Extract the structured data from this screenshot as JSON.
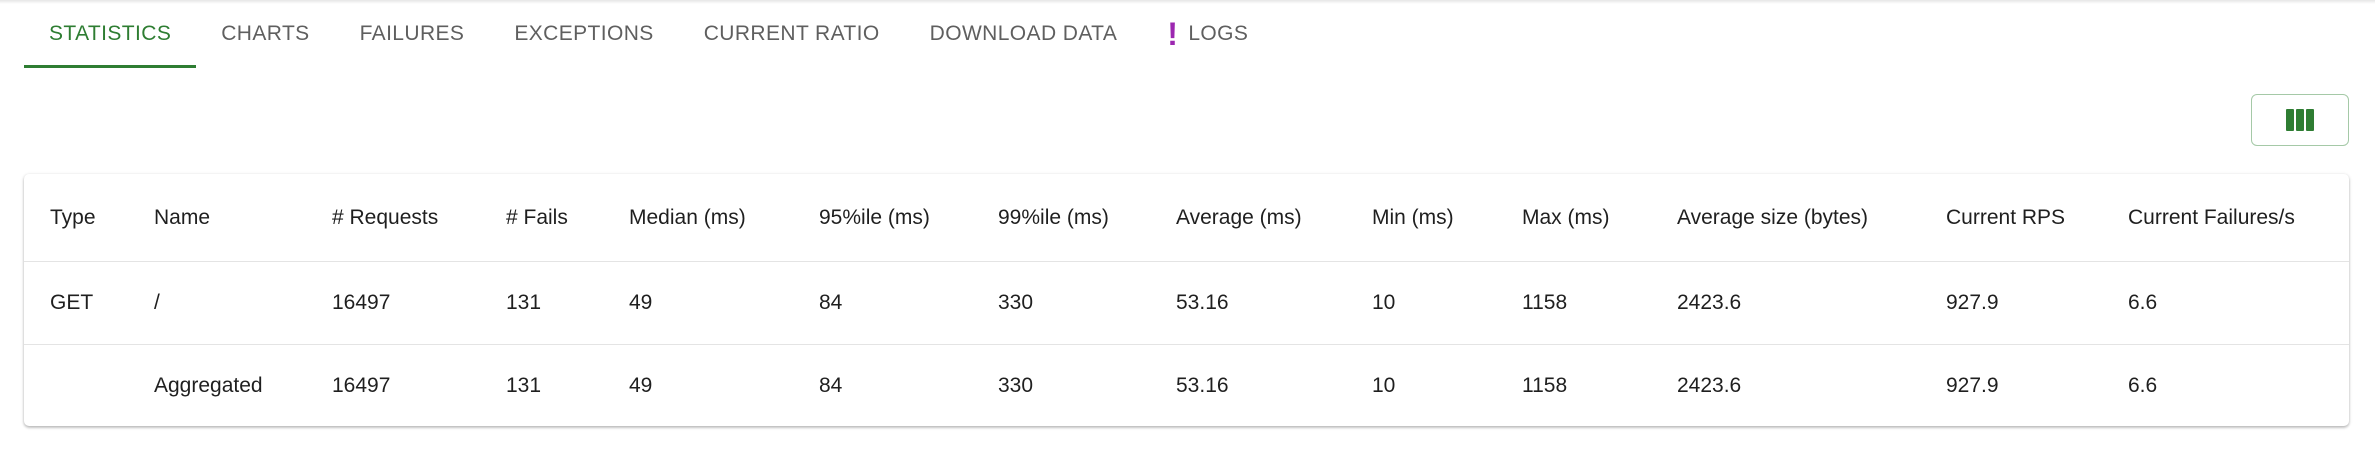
{
  "tabs": [
    {
      "label": "STATISTICS",
      "active": true
    },
    {
      "label": "CHARTS"
    },
    {
      "label": "FAILURES"
    },
    {
      "label": "EXCEPTIONS"
    },
    {
      "label": "CURRENT RATIO"
    },
    {
      "label": "DOWNLOAD DATA"
    },
    {
      "label": "LOGS",
      "icon": "exclamation-icon"
    }
  ],
  "toolbar": {
    "columns_icon": "view-columns-icon"
  },
  "table": {
    "headers": [
      "Type",
      "Name",
      "# Requests",
      "# Fails",
      "Median (ms)",
      "95%ile (ms)",
      "99%ile (ms)",
      "Average (ms)",
      "Min (ms)",
      "Max (ms)",
      "Average size (bytes)",
      "Current RPS",
      "Current Failures/s"
    ],
    "rows": [
      [
        "GET",
        "/",
        "16497",
        "131",
        "49",
        "84",
        "330",
        "53.16",
        "10",
        "1158",
        "2423.6",
        "927.9",
        "6.6"
      ],
      [
        "",
        "Aggregated",
        "16497",
        "131",
        "49",
        "84",
        "330",
        "53.16",
        "10",
        "1158",
        "2423.6",
        "927.9",
        "6.6"
      ]
    ]
  },
  "colors": {
    "accent": "#2e7d32",
    "warning": "#9c27b0"
  }
}
